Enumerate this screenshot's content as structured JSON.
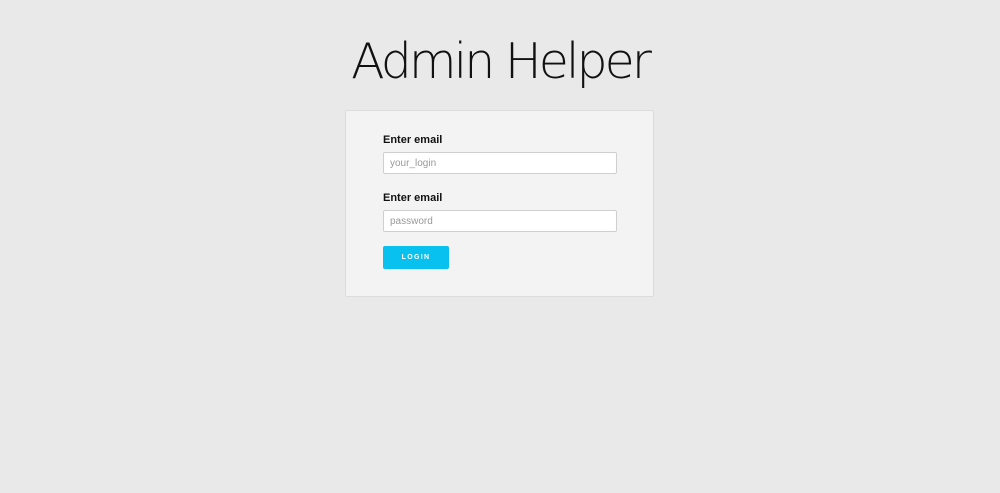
{
  "app": {
    "title": "Admin Helper"
  },
  "login_form": {
    "email_label": "Enter email",
    "email_placeholder": "your_login",
    "email_value": "",
    "password_label": "Enter email",
    "password_placeholder": "password",
    "password_value": "",
    "submit_label": "LOGIN"
  },
  "colors": {
    "page_background": "#e9e9e9",
    "card_background": "#f3f3f3",
    "accent": "#08c1ef"
  }
}
